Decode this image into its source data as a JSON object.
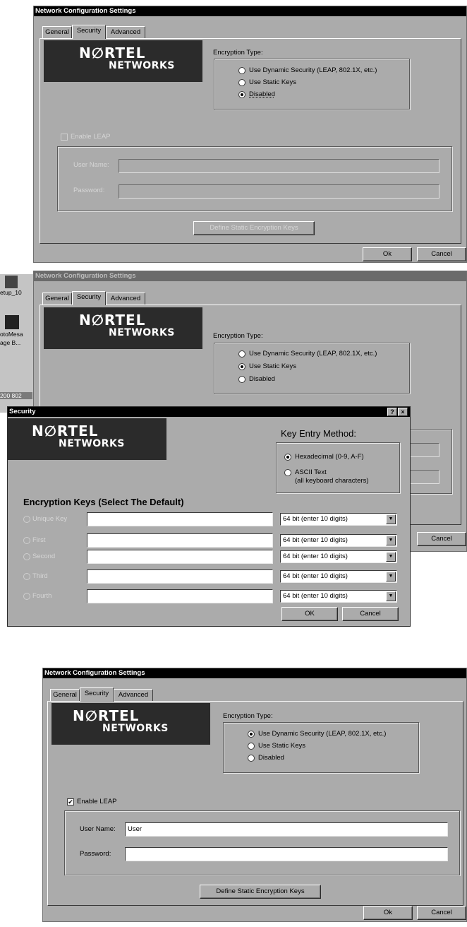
{
  "screen1": {
    "title": "Network Configuration Settings",
    "tabs": [
      "General",
      "Security",
      "Advanced"
    ],
    "logo": {
      "line1": "N∅RTEL",
      "line2": "NETWORKS"
    },
    "encryption_label": "Encryption Type:",
    "options": [
      "Use Dynamic Security (LEAP, 802.1X, etc.)",
      "Use Static Keys",
      "Disabled"
    ],
    "selected_option": "Disabled",
    "enable_leap": "Enable LEAP",
    "username_label": "User Name:",
    "password_label": "Password:",
    "username_value": "",
    "define_keys": "Define Static Encryption Keys",
    "ok": "Ok",
    "cancel": "Cancel"
  },
  "screen2": {
    "title": "Network Configuration Settings",
    "tabs": [
      "General",
      "Security",
      "Advanced"
    ],
    "logo": {
      "line1": "N∅RTEL",
      "line2": "NETWORKS"
    },
    "encryption_label": "Encryption Type:",
    "options": [
      "Use Dynamic Security (LEAP, 802.1X, etc.)",
      "Use Static Keys",
      "Disabled"
    ],
    "selected_option": "Use Static Keys",
    "cancel": "Cancel",
    "desktop_icons": [
      "etup_10",
      "otoMesa",
      "age B...",
      "200 802"
    ],
    "dialog": {
      "title": "Security",
      "help_btn": "?",
      "close_btn": "×",
      "logo": {
        "line1": "N∅RTEL",
        "line2": "NETWORKS"
      },
      "key_entry_label": "Key Entry Method:",
      "key_methods": [
        "Hexadecimal (0-9, A-F)",
        "ASCII Text",
        "(all keyboard characters)"
      ],
      "selected_method": "Hexadecimal (0-9, A-F)",
      "keys_heading": "Encryption Keys (Select The Default)",
      "keys": [
        {
          "label": "Unique Key",
          "value": "",
          "size": "64 bit (enter 10 digits)"
        },
        {
          "label": "First",
          "value": "",
          "size": "64 bit (enter 10 digits)"
        },
        {
          "label": "Second",
          "value": "",
          "size": "64 bit (enter 10 digits)"
        },
        {
          "label": "Third",
          "value": "",
          "size": "64 bit (enter 10 digits)"
        },
        {
          "label": "Fourth",
          "value": "",
          "size": "64 bit (enter 10 digits)"
        }
      ],
      "ok": "OK",
      "cancel": "Cancel"
    }
  },
  "screen3": {
    "title": "Network Configuration Settings",
    "tabs": [
      "General",
      "Security",
      "Advanced"
    ],
    "logo": {
      "line1": "N∅RTEL",
      "line2": "NETWORKS"
    },
    "encryption_label": "Encryption Type:",
    "options": [
      "Use Dynamic Security (LEAP, 802.1X, etc.)",
      "Use Static Keys",
      "Disabled"
    ],
    "selected_option": "Use Dynamic Security (LEAP, 802.1X, etc.)",
    "enable_leap": "Enable LEAP",
    "leap_checked": "✔",
    "username_label": "User Name:",
    "password_label": "Password:",
    "username_value": "User",
    "define_keys": "Define Static Encryption Keys",
    "ok": "Ok",
    "cancel": "Cancel"
  },
  "colors": {
    "dialog_bg": "#ababab",
    "title_active": "#000000",
    "title_inactive": "#6b6b6b",
    "logo_bg": "#2b2b2b"
  }
}
